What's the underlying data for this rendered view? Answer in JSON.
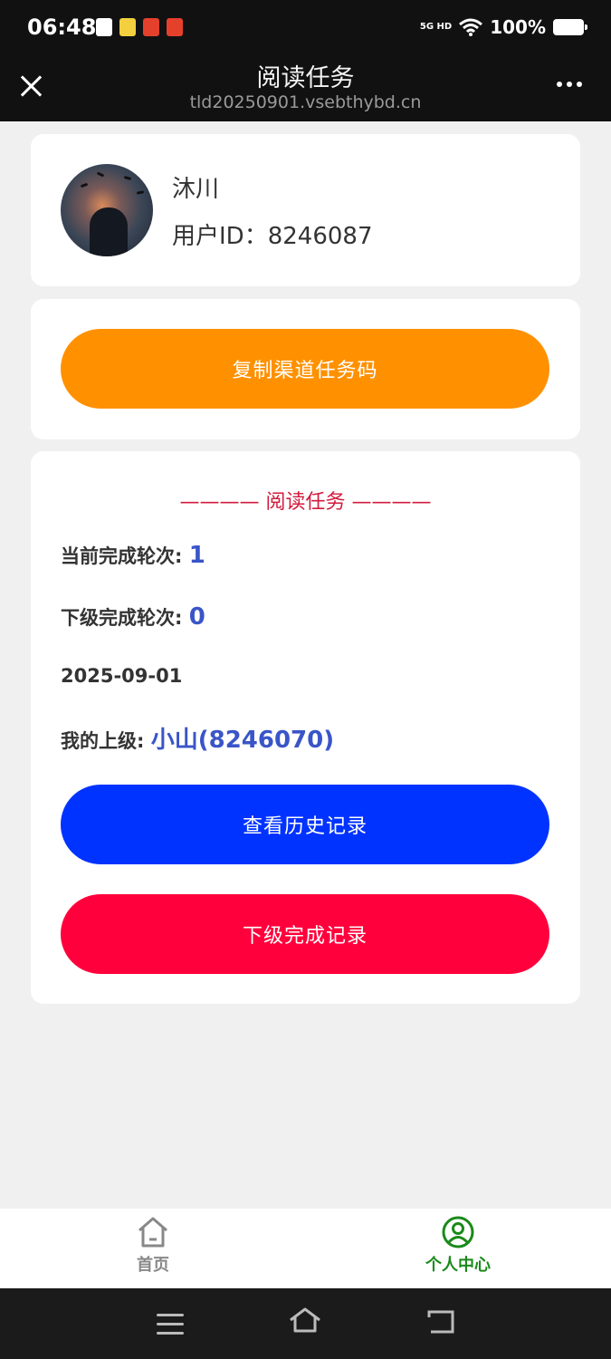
{
  "status_bar": {
    "time": "06:48",
    "network": "5G HD",
    "battery": "100%"
  },
  "title_bar": {
    "title": "阅读任务",
    "url": "tld20250901.vsebthybd.cn",
    "close_icon": "close-icon",
    "more_icon": "more-icon"
  },
  "user": {
    "name": "沐川",
    "id_label": "用户ID：",
    "id": "8246087"
  },
  "copy_button": "复制渠道任务码",
  "task": {
    "header": "———— 阅读任务 ————",
    "current_label": "当前完成轮次: ",
    "current_value": "1",
    "sub_label": "下级完成轮次: ",
    "sub_value": "0",
    "date": "2025-09-01",
    "parent_label": "我的上级: ",
    "parent_value": "小山(8246070)",
    "history_button": "查看历史记录",
    "sub_records_button": "下级完成记录"
  },
  "bottom_nav": {
    "home_label": "首页",
    "me_label": "个人中心",
    "active": "个人中心"
  },
  "colors": {
    "orange": "#ff9100",
    "blue": "#0033ff",
    "red": "#ff003c",
    "value_blue": "#3a55c8",
    "active_green": "#1a8a1a"
  }
}
